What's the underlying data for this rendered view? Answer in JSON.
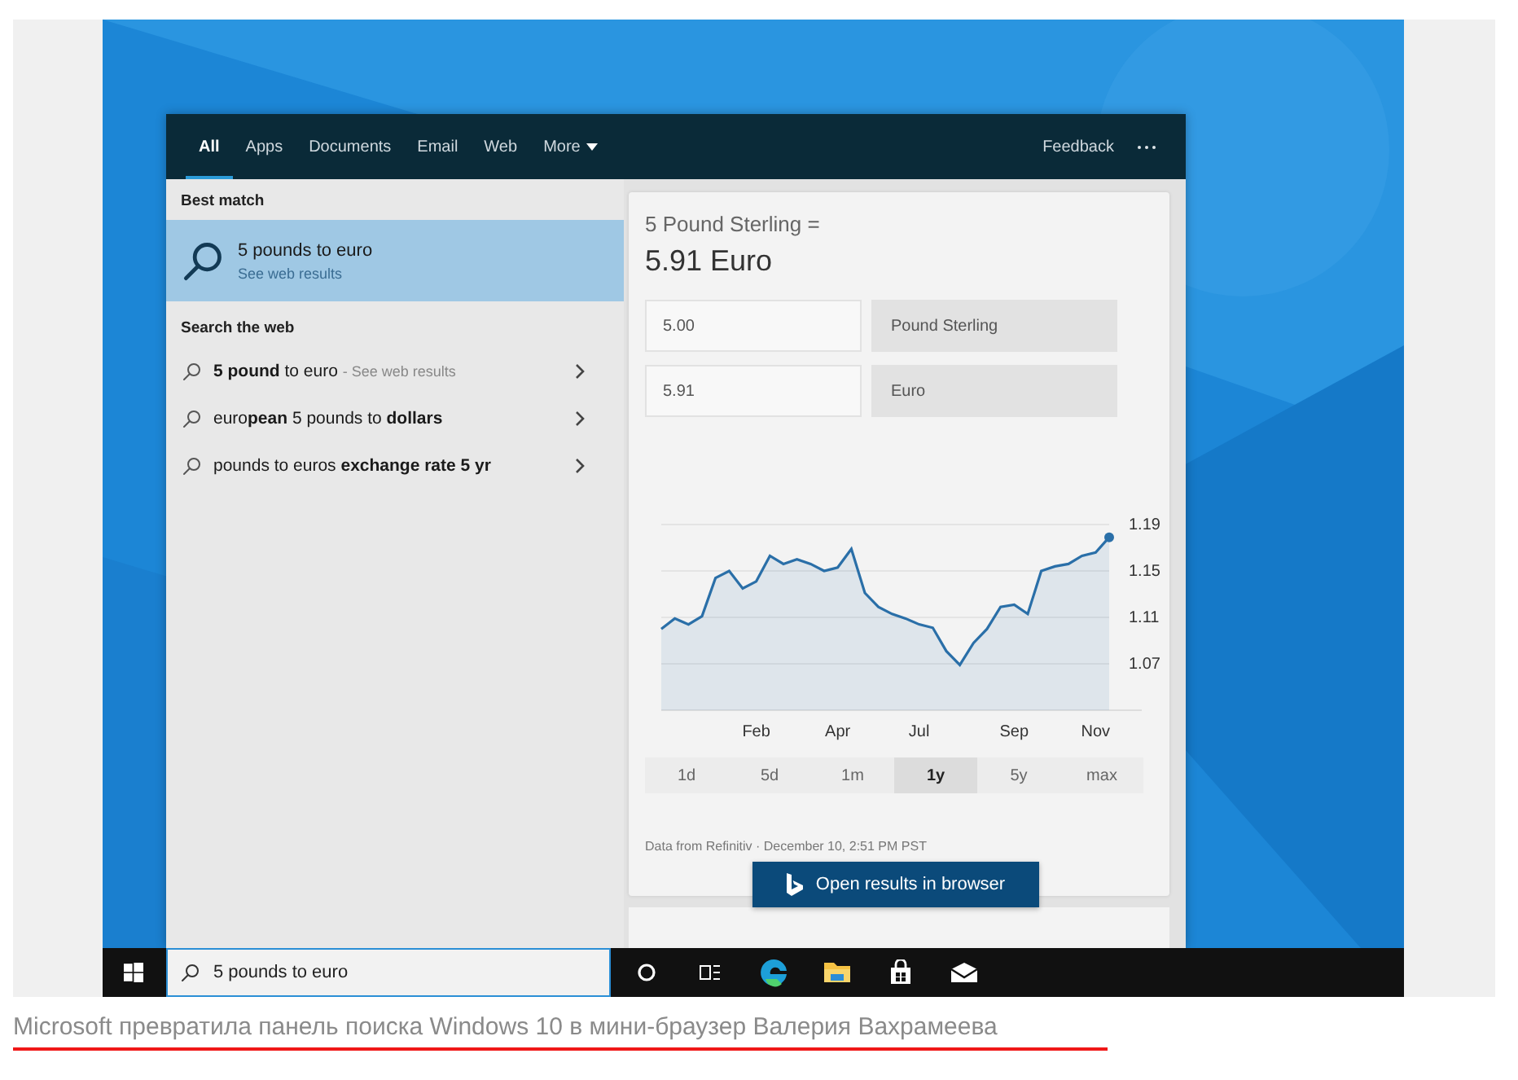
{
  "tabs": [
    {
      "label": "All",
      "selected": true,
      "kind": "tab"
    },
    {
      "label": "Apps",
      "selected": false,
      "kind": "tab"
    },
    {
      "label": "Documents",
      "selected": false,
      "kind": "tab"
    },
    {
      "label": "Email",
      "selected": false,
      "kind": "tab"
    },
    {
      "label": "Web",
      "selected": false,
      "kind": "tab"
    },
    {
      "label": "More",
      "selected": false,
      "kind": "dropdown"
    }
  ],
  "feedback": "Feedback",
  "best_match": {
    "heading": "Best match",
    "title": "5 pounds to euro",
    "subtitle": "See web results",
    "selected": true
  },
  "web_search": {
    "heading": "Search the web",
    "items": [
      {
        "text": "**5 pound** to euro",
        "hint": "- See web results"
      },
      {
        "text": "euro**pean** 5 pounds to **dollars**"
      },
      {
        "text": "pounds to euros **exchange rate 5 yr**"
      }
    ]
  },
  "answer": {
    "heading": "5 Pound Sterling =",
    "result": "5.91 Euro",
    "rows": [
      {
        "amount": "5.00",
        "currency": "Pound Sterling"
      },
      {
        "amount": "5.91",
        "currency": "Euro"
      }
    ],
    "chart_data": {
      "type": "area",
      "categories": [
        null,
        null,
        null,
        null,
        null,
        null,
        null,
        "Feb",
        null,
        null,
        null,
        null,
        null,
        "Apr",
        null,
        null,
        null,
        null,
        null,
        "Jul",
        null,
        null,
        null,
        null,
        null,
        null,
        "Sep",
        null,
        null,
        null,
        null,
        null,
        "Nov",
        null
      ],
      "series": [
        {
          "color": "#2a6fa8",
          "values": [
            1.1,
            1.109,
            1.104,
            1.111,
            1.144,
            1.15,
            1.135,
            1.141,
            1.163,
            1.156,
            1.16,
            1.156,
            1.15,
            1.153,
            1.169,
            1.131,
            1.119,
            1.113,
            1.109,
            1.104,
            1.101,
            1.081,
            1.069,
            1.088,
            1.1,
            1.119,
            1.121,
            1.113,
            1.15,
            1.154,
            1.156,
            1.163,
            1.166,
            1.179
          ]
        }
      ],
      "ylim": [
        1.03,
        1.19
      ],
      "grid": true,
      "yticks": [
        1.07,
        1.11,
        1.15,
        1.19
      ]
    },
    "ranges": [
      {
        "label": "1d",
        "selected": false
      },
      {
        "label": "5d",
        "selected": false
      },
      {
        "label": "1m",
        "selected": false
      },
      {
        "label": "1y",
        "selected": true
      },
      {
        "label": "5y",
        "selected": false
      },
      {
        "label": "max",
        "selected": false
      }
    ],
    "source": "Data from Refinitiv · December 10, 2:51 PM PST",
    "open_button": "Open results in browser"
  },
  "taskbar": {
    "search_value": "5 pounds to euro"
  },
  "caption": "Microsoft превратила панель поиска Windows 10 в мини-браузер Валерия Вахрамеева"
}
